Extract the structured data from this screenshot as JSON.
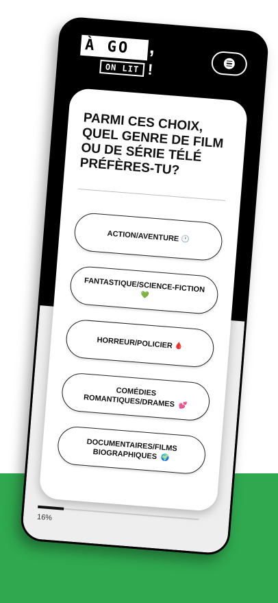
{
  "logo": {
    "main": "À GO",
    "comma": ",",
    "sub": "ON LIT",
    "bang": "!"
  },
  "menu": {
    "icon": "hamburger-icon"
  },
  "question": "PARMI CES CHOIX, QUEL GENRE DE FILM OU DE SÉRIE TÉLÉ PRÉFÈRES-TU?",
  "choices": [
    {
      "label": "ACTION/AVENTURE",
      "emoji": "🕐"
    },
    {
      "label": "FANTASTIQUE/SCIENCE-FICTION",
      "emoji": "💚"
    },
    {
      "label": "HORREUR/POLICIER",
      "emoji": "🩸"
    },
    {
      "label": "COMÉDIES ROMANTIQUES/DRAMES",
      "emoji": "💕"
    },
    {
      "label": "DOCUMENTAIRES/FILMS BIOGRAPHIQUES",
      "emoji": "🌍"
    }
  ],
  "progress": {
    "value": 0.16,
    "label": "16%"
  },
  "colors": {
    "accent": "#2fa84f",
    "phone": "#000000",
    "card": "#ffffff"
  }
}
